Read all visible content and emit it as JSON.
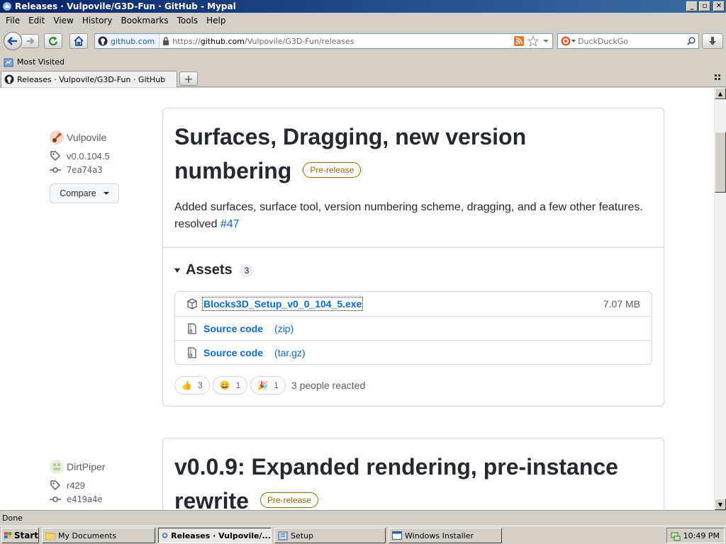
{
  "window": {
    "title": "Releases · Vulpovile/G3D-Fun · GitHub - Mypal",
    "minimize": "_",
    "maximize": "▫",
    "close": "✕"
  },
  "menu": [
    "File",
    "Edit",
    "View",
    "History",
    "Bookmarks",
    "Tools",
    "Help"
  ],
  "navbar": {
    "identity": "github.com",
    "url_prefix": "https://",
    "url_domain": "github.com",
    "url_path": "/Vulpovile/G3D-Fun/releases",
    "search_placeholder": "DuckDuckGo"
  },
  "bookmarks": {
    "most_visited": "Most Visited"
  },
  "tab": {
    "title": "Releases · Vulpovile/G3D-Fun · GitHub",
    "new_tab": "+"
  },
  "releases": [
    {
      "author": "Vulpovile",
      "tag": "v0.0.104.5",
      "commit": "7ea74a3",
      "compare": "Compare",
      "title_line1": "Surfaces, Dragging, new version",
      "title_line2": "numbering",
      "badge": "Pre-release",
      "desc": "Added surfaces, surface tool, version numbering scheme, dragging, and a few other features. resolved ",
      "desc_link": "#47",
      "assets_label": "Assets",
      "assets_count": "3",
      "assets": [
        {
          "name": "Blocks3D_Setup_v0_0_104_5.exe",
          "size": "7.07 MB",
          "icon": "package-icon"
        },
        {
          "name": "Source code",
          "sub": "(zip)",
          "icon": "file-zip-icon"
        },
        {
          "name": "Source code",
          "sub": "(tar.gz)",
          "icon": "file-zip-icon"
        }
      ],
      "reactions": [
        {
          "emoji": "👍",
          "count": "3"
        },
        {
          "emoji": "😄",
          "count": "1"
        },
        {
          "emoji": "🎉",
          "count": "1"
        }
      ],
      "reacted_text": "3 people reacted"
    },
    {
      "author": "DirtPiper",
      "tag": "r429",
      "commit": "e419a4e",
      "title_line1": "v0.0.9: Expanded rendering, pre-instance",
      "title_line2": "rewrite",
      "badge": "Pre-release"
    }
  ],
  "status": "Done",
  "taskbar": {
    "start": "Start",
    "tasks": [
      "My Documents",
      "Releases · Vulpovile/...",
      "Setup",
      "Windows Installer"
    ],
    "clock": "10:49 PM"
  },
  "colors": {
    "link": "#0969da",
    "badge": "#9a6700",
    "titlebar": "#0a246a"
  }
}
